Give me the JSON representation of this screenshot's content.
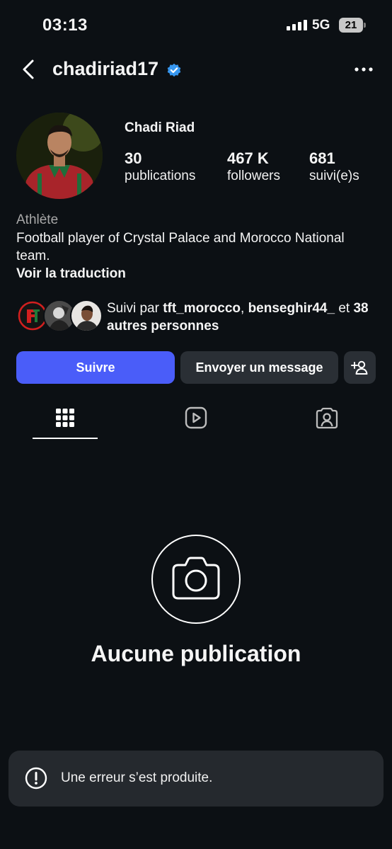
{
  "status_bar": {
    "time": "03:13",
    "network": "5G",
    "battery": "21"
  },
  "header": {
    "username": "chadiriad17"
  },
  "profile": {
    "display_name": "Chadi Riad",
    "stats": [
      {
        "value": "30",
        "label": "publications"
      },
      {
        "value": "467 K",
        "label": "followers"
      },
      {
        "value": "681",
        "label": "suivi(e)s"
      }
    ],
    "category": "Athlète",
    "bio": "Football player of Crystal Palace and Morocco National team.",
    "translate_label": "Voir la traduction",
    "followed_by": {
      "prefix": "Suivi par",
      "user1": "tft_morocco",
      "separator": ",",
      "user2": "benseghir44_",
      "connector": "et",
      "others": "38 autres personnes"
    }
  },
  "actions": {
    "follow_label": "Suivre",
    "message_label": "Envoyer un message"
  },
  "tabs": [
    "grid-icon",
    "reels-icon",
    "tagged-icon"
  ],
  "empty_state": {
    "title": "Aucune publication"
  },
  "toast": {
    "message": "Une erreur s’est produite."
  },
  "colors": {
    "background": "#0c1014",
    "accent": "#4a5df9",
    "verified": "#3797f0",
    "button_secondary": "#2a2f35"
  }
}
